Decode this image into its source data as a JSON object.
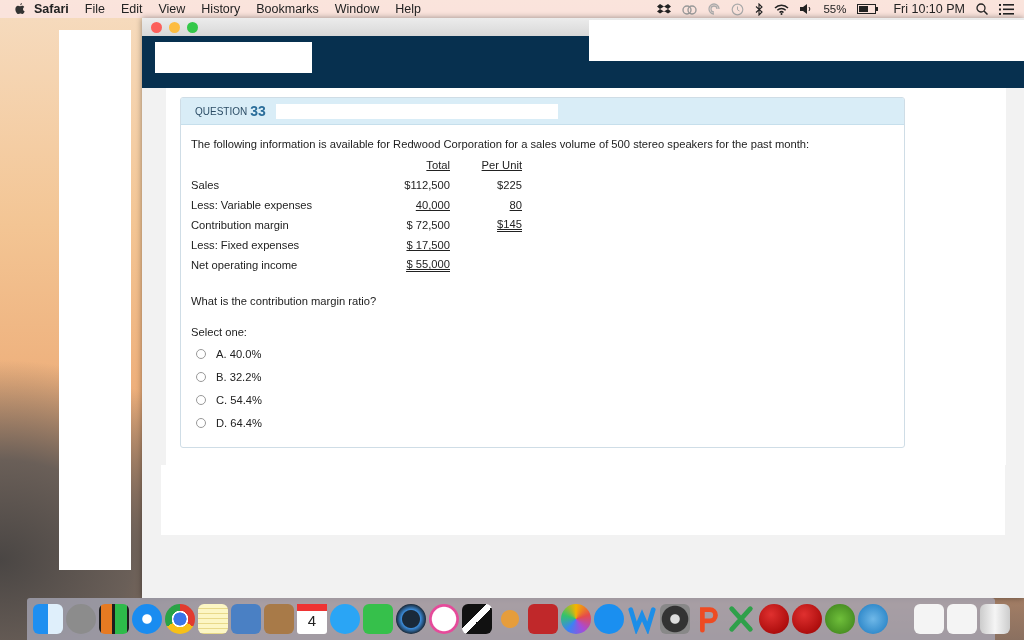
{
  "menu_bar": {
    "menus": [
      "Safari",
      "File",
      "Edit",
      "View",
      "History",
      "Bookmarks",
      "Window",
      "Help"
    ],
    "battery": "55%",
    "clock": "Fri 10:10 PM"
  },
  "question": {
    "label": "QUESTION",
    "number": "33",
    "intro": "The following information is available for Redwood Corporation for a sales volume of 500 stereo speakers for the past month:",
    "table": {
      "columns": [
        "Total",
        "Per Unit"
      ],
      "rows": [
        {
          "label": "Sales",
          "total": {
            "text": "$112,500",
            "underlined": false,
            "double_underlined": false
          },
          "per_unit": {
            "text": "$225",
            "underlined": false,
            "double_underlined": false
          }
        },
        {
          "label": "Less: Variable expenses",
          "total": {
            "text": "40,000",
            "underlined": true,
            "double_underlined": false
          },
          "per_unit": {
            "text": "80",
            "underlined": true,
            "double_underlined": false
          }
        },
        {
          "label": "Contribution margin",
          "total": {
            "text": "$ 72,500",
            "underlined": false,
            "double_underlined": false
          },
          "per_unit": {
            "text": "$145",
            "underlined": true,
            "double_underlined": true
          }
        },
        {
          "label": "Less: Fixed expenses",
          "total": {
            "text": "$ 17,500",
            "underlined": true,
            "double_underlined": false
          }
        },
        {
          "label": "Net operating income",
          "total": {
            "text": "$ 55,000",
            "underlined": true,
            "double_underlined": true
          }
        }
      ]
    },
    "prompt": "What is the contribution margin ratio?",
    "select_label": "Select one:",
    "options": [
      {
        "label": "A. 40.0%",
        "selected": false
      },
      {
        "label": "B. 32.2%",
        "selected": false
      },
      {
        "label": "C. 54.4%",
        "selected": false
      },
      {
        "label": "D. 64.4%",
        "selected": false
      }
    ]
  },
  "dock": {
    "calendar_day": "4"
  }
}
